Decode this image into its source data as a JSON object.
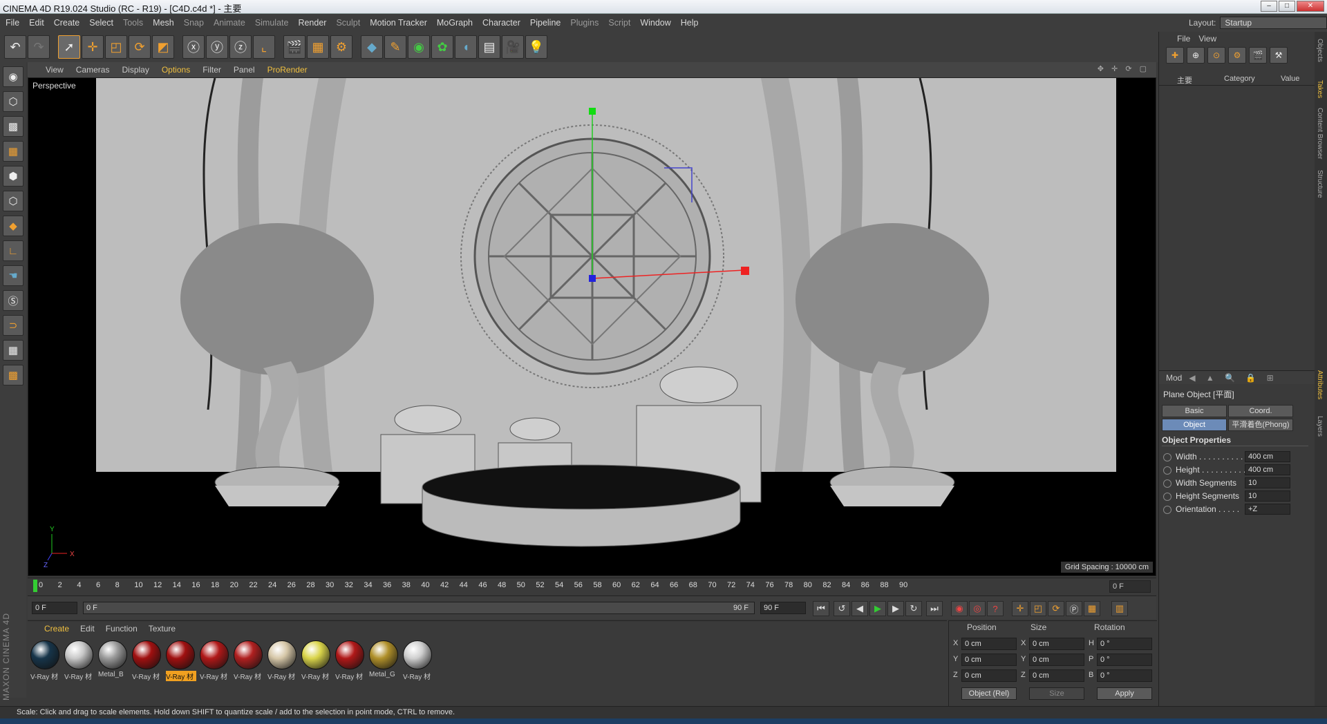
{
  "title": "CINEMA 4D R19.024 Studio (RC - R19) - [C4D.c4d *] - 主要",
  "menu": [
    "File",
    "Edit",
    "Create",
    "Select",
    "Tools",
    "Mesh",
    "Snap",
    "Animate",
    "Simulate",
    "Render",
    "Sculpt",
    "Motion Tracker",
    "MoGraph",
    "Character",
    "Pipeline",
    "Plugins",
    "Script",
    "Window",
    "Help"
  ],
  "layout": {
    "label": "Layout:",
    "value": "Startup"
  },
  "viewport": {
    "menu": [
      "View",
      "Cameras",
      "Display",
      "Options",
      "Filter",
      "Panel",
      "ProRender"
    ],
    "label": "Perspective",
    "grid_spacing": "Grid Spacing : 10000 cm",
    "axis_labels": {
      "y": "Y",
      "x": "X",
      "z": "Z"
    }
  },
  "timeline": {
    "ticks": [
      "0",
      "2",
      "4",
      "6",
      "8",
      "10",
      "12",
      "14",
      "16",
      "18",
      "20",
      "22",
      "24",
      "26",
      "28",
      "30",
      "32",
      "34",
      "36",
      "38",
      "40",
      "42",
      "44",
      "46",
      "48",
      "50",
      "52",
      "54",
      "56",
      "58",
      "60",
      "62",
      "64",
      "66",
      "68",
      "70",
      "72",
      "74",
      "76",
      "78",
      "80",
      "82",
      "84",
      "86",
      "88",
      "90"
    ],
    "current_frame": "0 F",
    "start_field": "0 F",
    "range_start": "0 F",
    "range_end": "90 F",
    "end_field": "90 F"
  },
  "materials": {
    "menu": [
      "Create",
      "Edit",
      "Function",
      "Texture"
    ],
    "items": [
      {
        "label": "V-Ray 材",
        "color": "#17354a",
        "selected": false
      },
      {
        "label": "V-Ray 材",
        "color": "#c8c8c8",
        "selected": false
      },
      {
        "label": "Metal_B",
        "color": "#9a9a9a",
        "selected": false
      },
      {
        "label": "V-Ray 材",
        "color": "#a01010",
        "selected": false
      },
      {
        "label": "V-Ray 材",
        "color": "#a01010",
        "selected": true
      },
      {
        "label": "V-Ray 材",
        "color": "#b01818",
        "selected": false
      },
      {
        "label": "V-Ray 材",
        "color": "#b02020",
        "selected": false
      },
      {
        "label": "V-Ray 材",
        "color": "#d6c7a8",
        "selected": false
      },
      {
        "label": "V-Ray 材",
        "color": "#d9d44a",
        "selected": false
      },
      {
        "label": "V-Ray 材",
        "color": "#b01818",
        "selected": false
      },
      {
        "label": "Metal_G",
        "color": "#b0902a",
        "selected": false
      },
      {
        "label": "V-Ray 材",
        "color": "#cfcfcf",
        "selected": false
      }
    ]
  },
  "coords": {
    "headers": [
      "Position",
      "Size",
      "Rotation"
    ],
    "rows": [
      {
        "axis": "X",
        "pos": "0 cm",
        "saxis": "X",
        "size": "0 cm",
        "raxis": "H",
        "rot": "0 °"
      },
      {
        "axis": "Y",
        "pos": "0 cm",
        "saxis": "Y",
        "size": "0 cm",
        "raxis": "P",
        "rot": "0 °"
      },
      {
        "axis": "Z",
        "pos": "0 cm",
        "saxis": "Z",
        "size": "0 cm",
        "raxis": "B",
        "rot": "0 °"
      }
    ],
    "mode": "Object (Rel)",
    "size_mode": "Size",
    "apply": "Apply"
  },
  "objects": {
    "menu": [
      "File",
      "View"
    ],
    "root": "主要",
    "col_category": "Category",
    "col_value": "Value"
  },
  "attributes": {
    "mode": "Mod",
    "object_name": "Plane Object [平面]",
    "tabs": [
      "Basic",
      "Coord.",
      "Object",
      "平滑着色(Phong)"
    ],
    "section": "Object Properties",
    "props": [
      {
        "label": "Width . . . . . . . . . .",
        "value": "400 cm"
      },
      {
        "label": "Height . . . . . . . . . .",
        "value": "400 cm"
      },
      {
        "label": "Width Segments",
        "value": "10"
      },
      {
        "label": "Height Segments",
        "value": "10"
      },
      {
        "label": "Orientation . . . . .",
        "value": "+Z"
      }
    ]
  },
  "side_tabs": [
    "Objects",
    "Takes",
    "Content Browser",
    "Structure",
    "Attributes",
    "Layers"
  ],
  "status": "Scale: Click and drag to scale elements. Hold down SHIFT to quantize scale / add to the selection in point mode, CTRL to remove.",
  "brand": "MAXON CINEMA 4D"
}
